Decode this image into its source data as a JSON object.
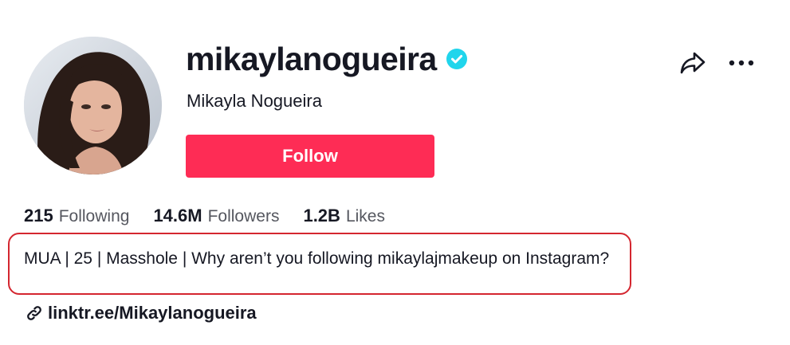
{
  "profile": {
    "username": "mikaylanogueira",
    "display_name": "Mikayla Nogueira",
    "verified": true,
    "follow_label": "Follow",
    "bio": "MUA | 25 | Masshole | Why aren’t you following mikaylajmakeup on Instagram?",
    "link": "linktr.ee/Mikaylanogueira"
  },
  "stats": [
    {
      "value": "215",
      "label": "Following"
    },
    {
      "value": "14.6M",
      "label": "Followers"
    },
    {
      "value": "1.2B",
      "label": "Likes"
    }
  ],
  "icons": {
    "verified": "verified-badge-icon",
    "share": "share-icon",
    "more": "more-options-icon",
    "link": "link-icon"
  },
  "colors": {
    "follow_button": "#fe2c55",
    "verified_badge": "#20d5ec",
    "bio_highlight_border": "#d4262f",
    "text": "#161823",
    "secondary_text": "#55575f"
  }
}
